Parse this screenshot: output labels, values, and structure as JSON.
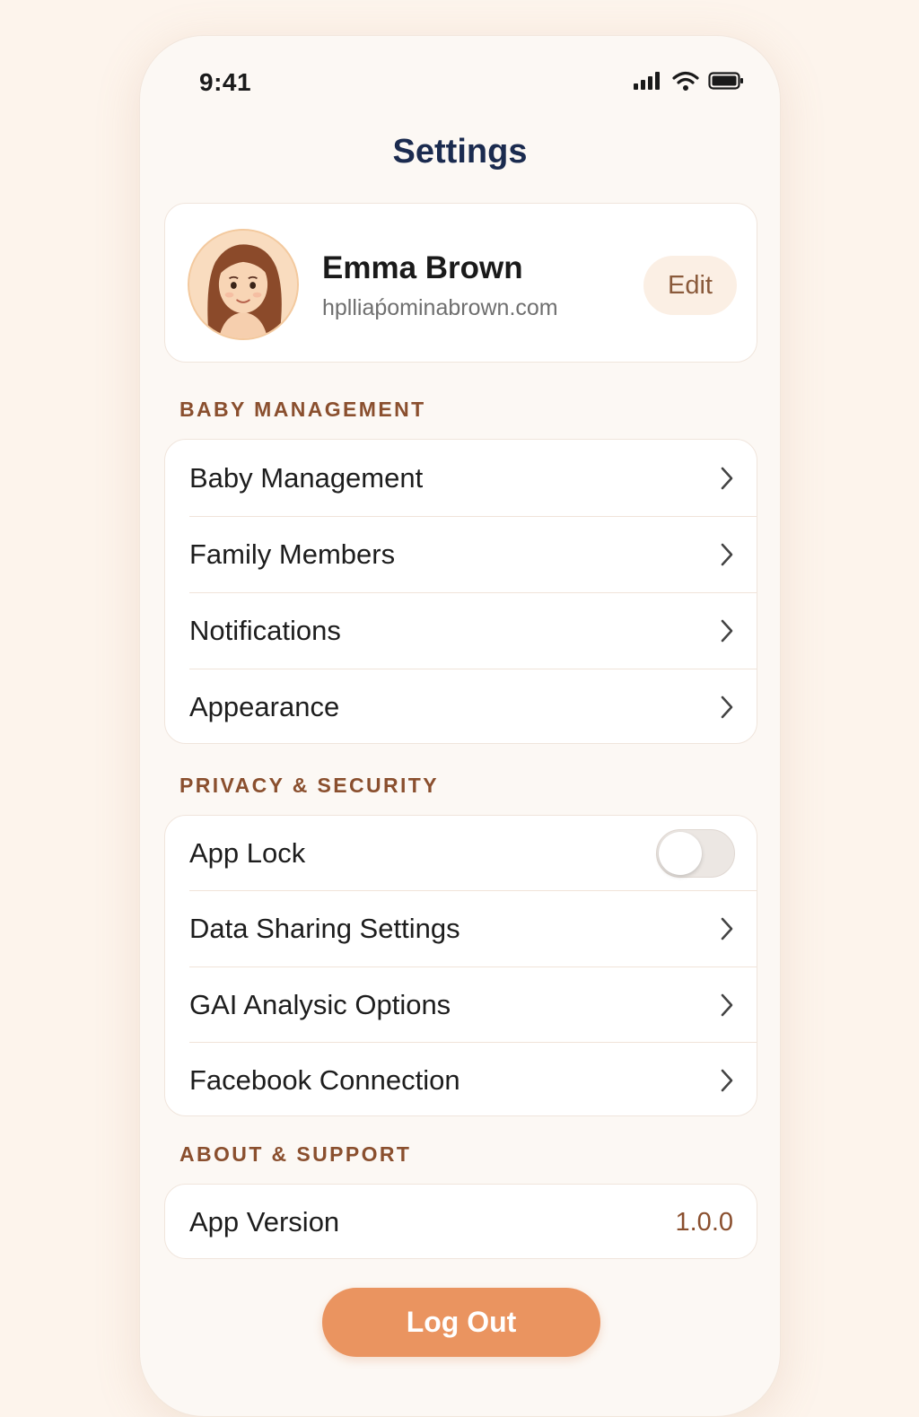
{
  "status_bar": {
    "time": "9:41",
    "icons": [
      "signal-icon",
      "wifi-icon",
      "battery-icon"
    ]
  },
  "header": {
    "title": "Settings"
  },
  "profile": {
    "name": "Emma Brown",
    "email": "hplliaṕominabrown.com",
    "edit_label": "Edit",
    "avatar_icon": "avatar"
  },
  "sections": {
    "baby": {
      "header": "BABY MANAGEMENT",
      "items": [
        {
          "label": "Baby Management"
        },
        {
          "label": "Family Members"
        },
        {
          "label": "Notifications"
        },
        {
          "label": "Appearance"
        }
      ]
    },
    "privacy": {
      "header": "PRIVACY & SECURITY",
      "app_lock": {
        "label": "App Lock",
        "enabled": false
      },
      "items": [
        {
          "label": "Data Sharing Settings"
        },
        {
          "label": "GAI Analysic Options"
        },
        {
          "label": "Facebook Connection"
        }
      ]
    },
    "about": {
      "header": "ABOUT & SUPPORT",
      "version_label": "App Version",
      "version_value": "1.0.0"
    }
  },
  "logout_label": "Log Out",
  "colors": {
    "accent": "#ea9460",
    "section_header": "#8a4f2e",
    "title": "#1b2b4f",
    "background": "#fdf4ec"
  }
}
